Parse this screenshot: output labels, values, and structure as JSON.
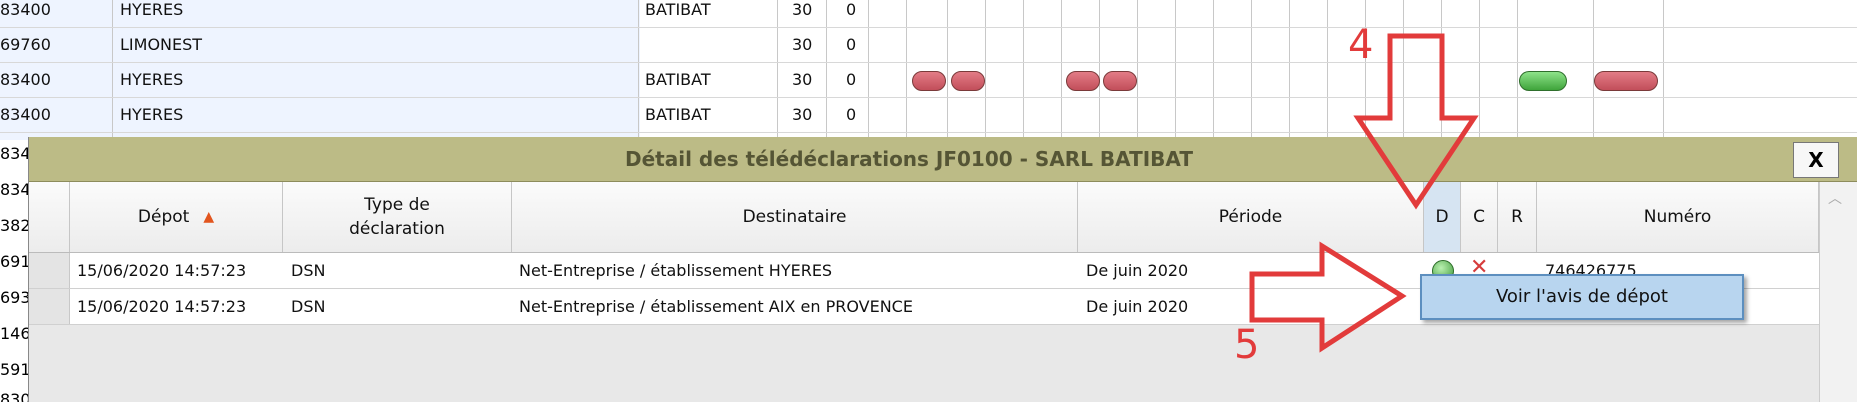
{
  "background": {
    "rows": [
      {
        "id": "83400",
        "city": "HYERES",
        "group": "BATIBAT",
        "a": "30",
        "b": "0"
      },
      {
        "id": "69760",
        "city": "LIMONEST",
        "group": "",
        "a": "30",
        "b": "0"
      },
      {
        "id": "83400",
        "city": "HYERES",
        "group": "BATIBAT",
        "a": "30",
        "b": "0"
      },
      {
        "id": "83400",
        "city": "HYERES",
        "group": "BATIBAT",
        "a": "30",
        "b": "0"
      }
    ],
    "left_ids": [
      "834",
      "834",
      "382",
      "691",
      "693",
      "146",
      "591",
      "830"
    ]
  },
  "dialog": {
    "title": "Détail des télédéclarations JF0100 - SARL BATIBAT",
    "close_label": "X",
    "columns": {
      "depot": "Dépot",
      "type": "Type de déclaration",
      "destinataire": "Destinataire",
      "periode": "Période",
      "d": "D",
      "c": "C",
      "r": "R",
      "numero": "Numéro"
    },
    "sort_indicator": "▲",
    "rows": [
      {
        "depot": "15/06/2020 14:57:23",
        "type": "DSN",
        "destinataire": "Net-Entreprise / établissement HYERES",
        "periode": "De juin 2020",
        "numero": "746426775"
      },
      {
        "depot": "15/06/2020 14:57:23",
        "type": "DSN",
        "destinataire": "Net-Entreprise / établissement AIX en PROVENCE",
        "periode": "De juin 2020",
        "numero": ""
      }
    ]
  },
  "context_menu": {
    "item": "Voir l'avis de dépot"
  },
  "annotations": {
    "step4": "4",
    "step5": "5"
  },
  "colors": {
    "titlebar": "#bcbb86",
    "annotation": "#e23b3b",
    "menu_bg": "#b8d5ef"
  }
}
